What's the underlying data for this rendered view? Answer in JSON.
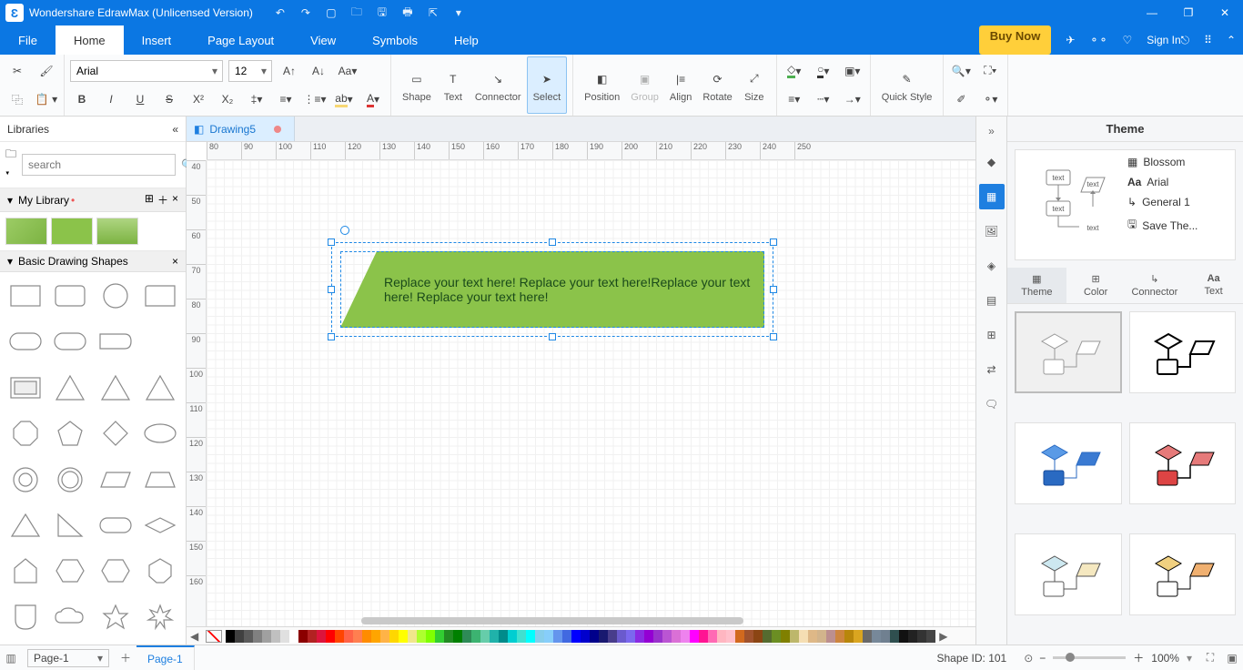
{
  "app": {
    "title": "Wondershare EdrawMax (Unlicensed Version)"
  },
  "menu": {
    "file": "File",
    "home": "Home",
    "insert": "Insert",
    "layout": "Page Layout",
    "view": "View",
    "symbols": "Symbols",
    "help": "Help",
    "buy": "Buy Now",
    "signin": "Sign In"
  },
  "ribbon": {
    "font": "Arial",
    "size": "12",
    "shape": "Shape",
    "text": "Text",
    "connector": "Connector",
    "select": "Select",
    "position": "Position",
    "group": "Group",
    "align": "Align",
    "rotate": "Rotate",
    "sizeGrp": "Size",
    "quick": "Quick Style"
  },
  "left": {
    "title": "Libraries",
    "placeholder": "search",
    "mylib": "My Library",
    "basic": "Basic Drawing Shapes"
  },
  "doc": {
    "tab": "Drawing5"
  },
  "canvas": {
    "shape_text": "Replace your text here!   Replace your text here!Replace your text here!   Replace your text here!",
    "hticks": [
      "80",
      "90",
      "100",
      "110",
      "120",
      "130",
      "140",
      "150",
      "160",
      "170",
      "180",
      "190",
      "200",
      "210",
      "220",
      "230",
      "240",
      "250"
    ],
    "vticks": [
      "40",
      "50",
      "60",
      "70",
      "80",
      "90",
      "100",
      "110",
      "120",
      "130",
      "140",
      "150",
      "160"
    ]
  },
  "right": {
    "title": "Theme",
    "opt_color": "Blossom",
    "opt_font": "Arial",
    "opt_conn": "General 1",
    "opt_save": "Save The...",
    "tab_theme": "Theme",
    "tab_color": "Color",
    "tab_conn": "Connector",
    "tab_text": "Text"
  },
  "status": {
    "pagedd": "Page-1",
    "pagetab": "Page-1",
    "shapeid": "Shape ID: 101",
    "zoom": "100%"
  },
  "colors": [
    "#000000",
    "#404040",
    "#5b5b5b",
    "#808080",
    "#a0a0a0",
    "#c0c0c0",
    "#e0e0e0",
    "#ffffff",
    "#8b0000",
    "#b22222",
    "#dc143c",
    "#ff0000",
    "#ff4500",
    "#ff6347",
    "#ff7f50",
    "#ff8c00",
    "#ffa500",
    "#ffb347",
    "#ffd700",
    "#ffff00",
    "#f0e68c",
    "#adff2f",
    "#7fff00",
    "#32cd32",
    "#228b22",
    "#008000",
    "#2e8b57",
    "#3cb371",
    "#66cdaa",
    "#20b2aa",
    "#008b8b",
    "#00ced1",
    "#40e0d0",
    "#00ffff",
    "#87ceeb",
    "#87cefa",
    "#6495ed",
    "#4169e1",
    "#0000ff",
    "#0000cd",
    "#00008b",
    "#191970",
    "#483d8b",
    "#6a5acd",
    "#7b68ee",
    "#8a2be2",
    "#9400d3",
    "#9932cc",
    "#ba55d3",
    "#da70d6",
    "#ee82ee",
    "#ff00ff",
    "#ff1493",
    "#ff69b4",
    "#ffb6c1",
    "#ffc0cb",
    "#d2691e",
    "#a0522d",
    "#8b4513",
    "#556b2f",
    "#6b8e23",
    "#808000",
    "#bdb76b",
    "#f5deb3",
    "#deb887",
    "#d2b48c",
    "#bc8f8f",
    "#cd853f",
    "#b8860b",
    "#daa520",
    "#696969",
    "#778899",
    "#708090",
    "#2f4f4f",
    "#111111",
    "#222222",
    "#333333",
    "#444444"
  ]
}
